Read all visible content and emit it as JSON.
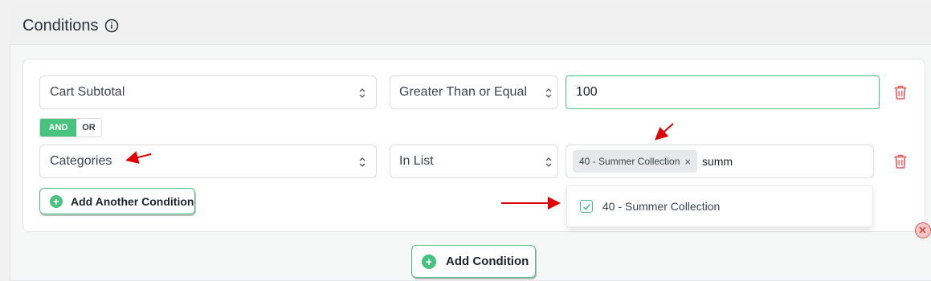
{
  "section": {
    "title": "Conditions"
  },
  "row1": {
    "field_value": "Cart Subtotal",
    "operator_value": "Greater Than or Equal",
    "amount_value": "100"
  },
  "logic": {
    "and_label": "AND",
    "or_label": "OR",
    "selected": "AND"
  },
  "row2": {
    "field_value": "Categories",
    "operator_value": "In List",
    "tag_label": "40 - Summer Collection",
    "tag_remove": "×",
    "search_text": "summ"
  },
  "dropdown": {
    "options": [
      {
        "label": "40 - Summer Collection",
        "checked": true
      }
    ]
  },
  "buttons": {
    "add_another_condition": "Add Another Condition",
    "add_condition": "Add Condition"
  },
  "colors": {
    "accent": "#48c37f",
    "danger": "#e35d5d",
    "annotation_arrow": "#e00000"
  },
  "icons": [
    "info-icon",
    "chevron-updown-icon",
    "trash-icon",
    "plus-icon",
    "check-icon",
    "close-icon",
    "arrow-annotation-icon"
  ]
}
